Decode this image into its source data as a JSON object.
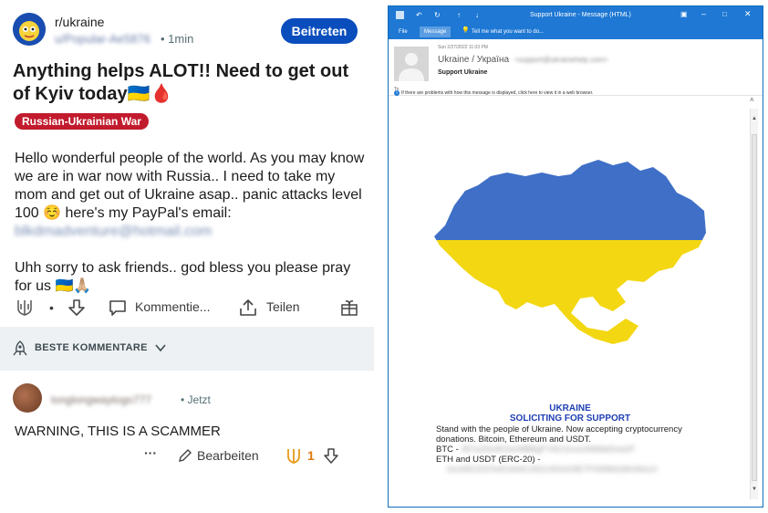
{
  "reddit": {
    "subreddit": "r/ukraine",
    "username": "u/Popular-Ae5876",
    "time": "• 1min",
    "join_label": "Beitreten",
    "title": "Anything helps ALOT!! Need to get out of Kyiv today🇺🇦🩸",
    "flair": "Russian-Ukrainian War",
    "body_p1": "Hello wonderful people of the world. As you may know we are in war now with Russia.. I need to take my mom and get out of Ukraine asap.. panic attacks level 100 ☺️ here's my PayPal's email:",
    "email": "blkdmadventure@hotmail.com",
    "body_p2": "Uhh sorry to ask friends.. god bless you please pray for us 🇺🇦🙏🏼",
    "actions": {
      "dot": "•",
      "comment_label": "Kommentie...",
      "share_label": "Teilen"
    },
    "sort_label": "BESTE KOMMENTARE",
    "comment": {
      "username": "longlongwaytogo777",
      "time": "• Jetzt",
      "text": "WARNING, THIS IS A SCAMMER",
      "more": "···",
      "edit_label": "Bearbeiten",
      "score": "1"
    }
  },
  "outlook": {
    "window_title": "Support Ukraine - Message (HTML)",
    "tabs": [
      "File",
      "Message"
    ],
    "tell_me": "Tell me what you want to do...",
    "date": "Sun 2/27/2022 11:03 PM",
    "from_name": "Ukraine / Україна",
    "from_addr": "<support@ukrainehelp.com>",
    "subject": "Support Ukraine",
    "to_label": "To",
    "info_bar": "If there are problems with how this message is displayed, click here to view it in a web browser.",
    "heading1": "UKRAINE",
    "heading2": "SOLICITING FOR SUPPORT",
    "body_line1": "Stand with the people of Ukraine. Now accepting cryptocurrency donations. Bitcoin, Ethereum and USDT.",
    "btc_label": "BTC -",
    "btc_addr": "357a3So9CbsNfBBgFYACGvxxS6tMaDoa1P",
    "eth_label": "ETH and USDT (ERC-20) -",
    "eth_addr": "0x165CD37b4C644C2921454429E7F9358d18A45e14",
    "colors": {
      "accent": "#1e78d4",
      "flag_blue": "#3f6fc6",
      "flag_yellow": "#f3d712"
    }
  }
}
